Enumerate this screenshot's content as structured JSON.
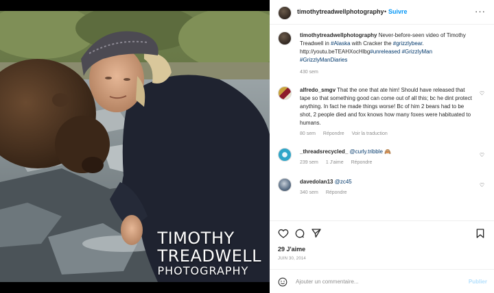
{
  "media": {
    "watermark": {
      "line1": "TIMOTHY",
      "line2": "TREADWELL",
      "line3": "PHOTOGRAPHY"
    }
  },
  "header": {
    "username": "timothytreadwellphotography",
    "separator": "•",
    "follow": "Suivre",
    "more": "···"
  },
  "caption": {
    "username": "timothytreadwellphotography",
    "text_before": "Never-before-seen video of Timothy Treadwell in ",
    "tag_alaska": "#Alaska",
    "text_mid": " with Cracker the ",
    "tag_grizzlybear": "#grizzlybear",
    "text_link": ". http://youtu.beTEAHXocHlbg",
    "tag_unreleased": "#unreleased",
    "tag_grizzlyman": "#GrizzlyMan",
    "tag_diaries": "#GrizzlyManDiaries",
    "time": "430 sem"
  },
  "comments": [
    {
      "username": "alfredo_smgv",
      "text": "That the one that ate him! Should have released that tape so that something good can come out of all this; bc he dint protect anything. In fact he made things worse! Bc of him 2 bears had to be shot, 2 people died and fox knows how many foxes were habituated to humans.",
      "time": "80 sem",
      "reply": "Répondre",
      "translate": "Voir la traduction"
    },
    {
      "username": "_threadsrecycled_",
      "mention": "@curly.tribble",
      "emoji": "🙈",
      "time": "239 sem",
      "likes": "1 J'aime",
      "reply": "Répondre"
    },
    {
      "username": "davedolan13",
      "mention": "@zc45",
      "time": "340 sem",
      "reply": "Répondre"
    }
  ],
  "footer": {
    "likes": "29 J'aime",
    "date": "JUIN 30, 2014",
    "add_comment_placeholder": "Ajouter un commentaire...",
    "publish": "Publier"
  },
  "colors": {
    "accent": "#0095f6",
    "hashtag": "#00376b",
    "muted": "#8e8e8e",
    "publish_disabled": "#b2dffc"
  }
}
